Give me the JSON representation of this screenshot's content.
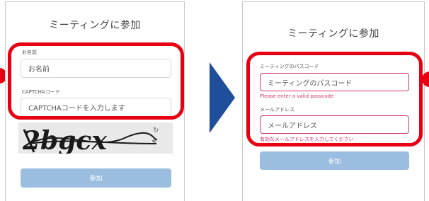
{
  "left_form": {
    "title": "ミーティングに参加",
    "name_label": "お名前",
    "name_placeholder": "お名前",
    "captcha_label": "CAPTCHAコード",
    "captcha_placeholder": "CAPTCHAコードを入力します",
    "captcha_text": "2bgcx",
    "refresh_icon": "refresh-icon",
    "audio_icon": "audio-icon",
    "join_label": "参加"
  },
  "right_form": {
    "title": "ミーティングに参加",
    "passcode_label": "ミーティングのパスコード",
    "passcode_placeholder": "ミーティングのパスコード",
    "passcode_error": "Please enter a valid passcode",
    "email_label": "メールアドレス",
    "email_placeholder": "メールアドレス",
    "email_error": "有効なメールアドレスを入力してください",
    "join_label": "参加"
  },
  "colors": {
    "highlight": "#e60012",
    "arrow": "#1f4e9a",
    "button": "#9bbde0",
    "error": "#d6336c"
  }
}
